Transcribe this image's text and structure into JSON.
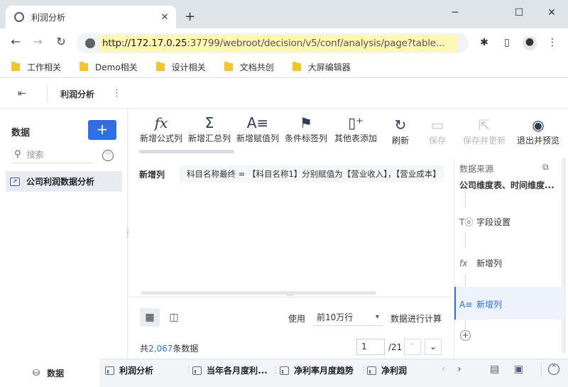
{
  "browser": {
    "tab_title": "利润分析",
    "url_prefix": "http://172.17.0.25",
    "url_rest": ":37799/webroot/decision/v5/conf/analysis/page?table...",
    "bookmarks": [
      "工作相关",
      "Demo相关",
      "设计相关",
      "文档共创",
      "大屏编辑器"
    ]
  },
  "app": {
    "title": "利润分析"
  },
  "left": {
    "heading": "数据",
    "add_label": "+",
    "search_placeholder": "搜索",
    "selected_item": "公司利润数据分析"
  },
  "toolbar": {
    "items": [
      {
        "label": "新增公式列",
        "icon": "fx"
      },
      {
        "label": "新增汇总列",
        "icon": "Σ"
      },
      {
        "label": "新增赋值列",
        "icon": "A="
      },
      {
        "label": "条件标签列",
        "icon": "flag"
      },
      {
        "label": "其他表添加",
        "icon": "table-add"
      },
      {
        "label": "刷新",
        "icon": "refresh"
      },
      {
        "label": "保存",
        "icon": "save"
      },
      {
        "label": "保存并更新",
        "icon": "save-update"
      },
      {
        "label": "退出并预览",
        "icon": "eye"
      }
    ]
  },
  "main": {
    "row_label": "新增列",
    "formula": "科目名称最终 = 【科目名称1】分别赋值为【营业收入】，【营业成本】",
    "use_label": "使用",
    "rows_option": "前10万行",
    "compute_label": "数据进行计算",
    "count_prefix": "共",
    "count_value": "2,067",
    "count_suffix": "条数据",
    "page_current": "1",
    "page_total": "/21"
  },
  "right": {
    "source_label": "数据来源",
    "source_value": "公司维度表、时间维度...",
    "steps": [
      {
        "label": "字段设置",
        "icon": "To"
      },
      {
        "label": "新增列",
        "icon": "fx"
      },
      {
        "label": "新增列",
        "icon": "A="
      }
    ]
  },
  "bottom": {
    "data_tab": "数据",
    "tabs": [
      "利润分析",
      "当年各月度利...",
      "净利率月度趋势",
      "净利润"
    ]
  }
}
